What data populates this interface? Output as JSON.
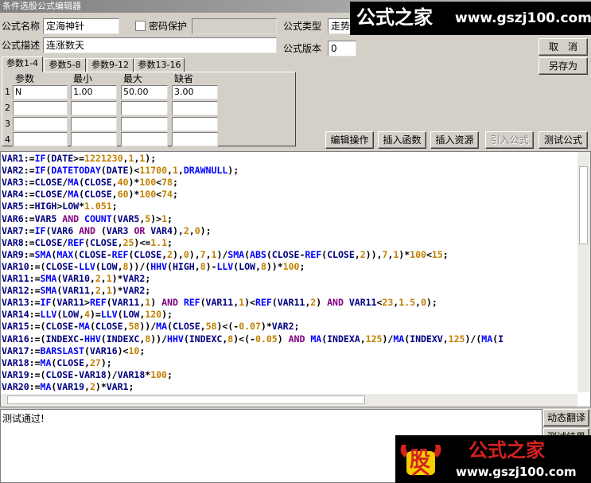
{
  "window": {
    "title": "条件选股公式编辑器"
  },
  "form": {
    "name_label": "公式名称",
    "name_value": "定海神针",
    "password_label": "密码保护",
    "password_checked": false,
    "password_value": "",
    "type_label": "公式类型",
    "type_value": "走势",
    "desc_label": "公式描述",
    "desc_value": "连涨数天",
    "version_label": "公式版本",
    "version_value": "0"
  },
  "buttons": {
    "cancel": "取　消",
    "save_as": "另存为",
    "edit_ops": "编辑操作",
    "insert_func": "插入函数",
    "insert_res": "插入资源",
    "import_formula": "引入公式",
    "test_formula": "测试公式",
    "dynamic_translate": "动态翻译",
    "test_result": "测试结果"
  },
  "tabs": [
    {
      "label": "参数1-4",
      "active": true
    },
    {
      "label": "参数5-8",
      "active": false
    },
    {
      "label": "参数9-12",
      "active": false
    },
    {
      "label": "参数13-16",
      "active": false
    }
  ],
  "params": {
    "headers": [
      "参数",
      "最小",
      "最大",
      "缺省"
    ],
    "rows": [
      {
        "num": "1",
        "name": "N",
        "min": "1.00",
        "max": "50.00",
        "default": "3.00"
      },
      {
        "num": "2",
        "name": "",
        "min": "",
        "max": "",
        "default": ""
      },
      {
        "num": "3",
        "name": "",
        "min": "",
        "max": "",
        "default": ""
      },
      {
        "num": "4",
        "name": "",
        "min": "",
        "max": "",
        "default": ""
      }
    ]
  },
  "code_lines": [
    "VAR1:=IF(DATE>=1221230,1,1);",
    "VAR2:=IF(DATETODAY(DATE)<11700,1,DRAWNULL);",
    "VAR3:=CLOSE/MA(CLOSE,40)*100<78;",
    "VAR4:=CLOSE/MA(CLOSE,60)*100<74;",
    "VAR5:=HIGH>LOW*1.051;",
    "VAR6:=VAR5 AND COUNT(VAR5,5)>1;",
    "VAR7:=IF(VAR6 AND (VAR3 OR VAR4),2,0);",
    "VAR8:=CLOSE/REF(CLOSE,25)<=1.1;",
    "VAR9:=SMA(MAX(CLOSE-REF(CLOSE,2),0),7,1)/SMA(ABS(CLOSE-REF(CLOSE,2)),7,1)*100<15;",
    "VAR10:=(CLOSE-LLV(LOW,8))/(HHV(HIGH,8)-LLV(LOW,8))*100;",
    "VAR11:=SMA(VAR10,2,1)*VAR2;",
    "VAR12:=SMA(VAR11,2,1)*VAR2;",
    "VAR13:=IF(VAR11>REF(VAR11,1) AND REF(VAR11,1)<REF(VAR11,2) AND VAR11<23,1.5,0);",
    "VAR14:=LLV(LOW,4)=LLV(LOW,120);",
    "VAR15:=(CLOSE-MA(CLOSE,58))/MA(CLOSE,58)<(-0.07)*VAR2;",
    "VAR16:=(INDEXC-HHV(INDEXC,8))/HHV(INDEXC,8)<(-0.05) AND MA(INDEXA,125)/MA(INDEXV,125)/(MA(I",
    "VAR17:=BARSLAST(VAR16)<10;",
    "VAR18:=MA(CLOSE,27);",
    "VAR19:=(CLOSE-VAR18)/VAR18*100;",
    "VAR20:=MA(VAR19,2)*VAR1;"
  ],
  "status": {
    "text": "测试通过!"
  },
  "watermark_top": {
    "brand": "公式之家",
    "url": "www.gszj100.com"
  },
  "watermark_bottom": {
    "glyph": "股",
    "brand": "公式之家",
    "url": "www.gszj100.com"
  },
  "colors": {
    "keyword": "#000080",
    "function": "#0000ff",
    "number": "#c08000",
    "logic": "#800080",
    "watermark_red": "#d62020"
  }
}
